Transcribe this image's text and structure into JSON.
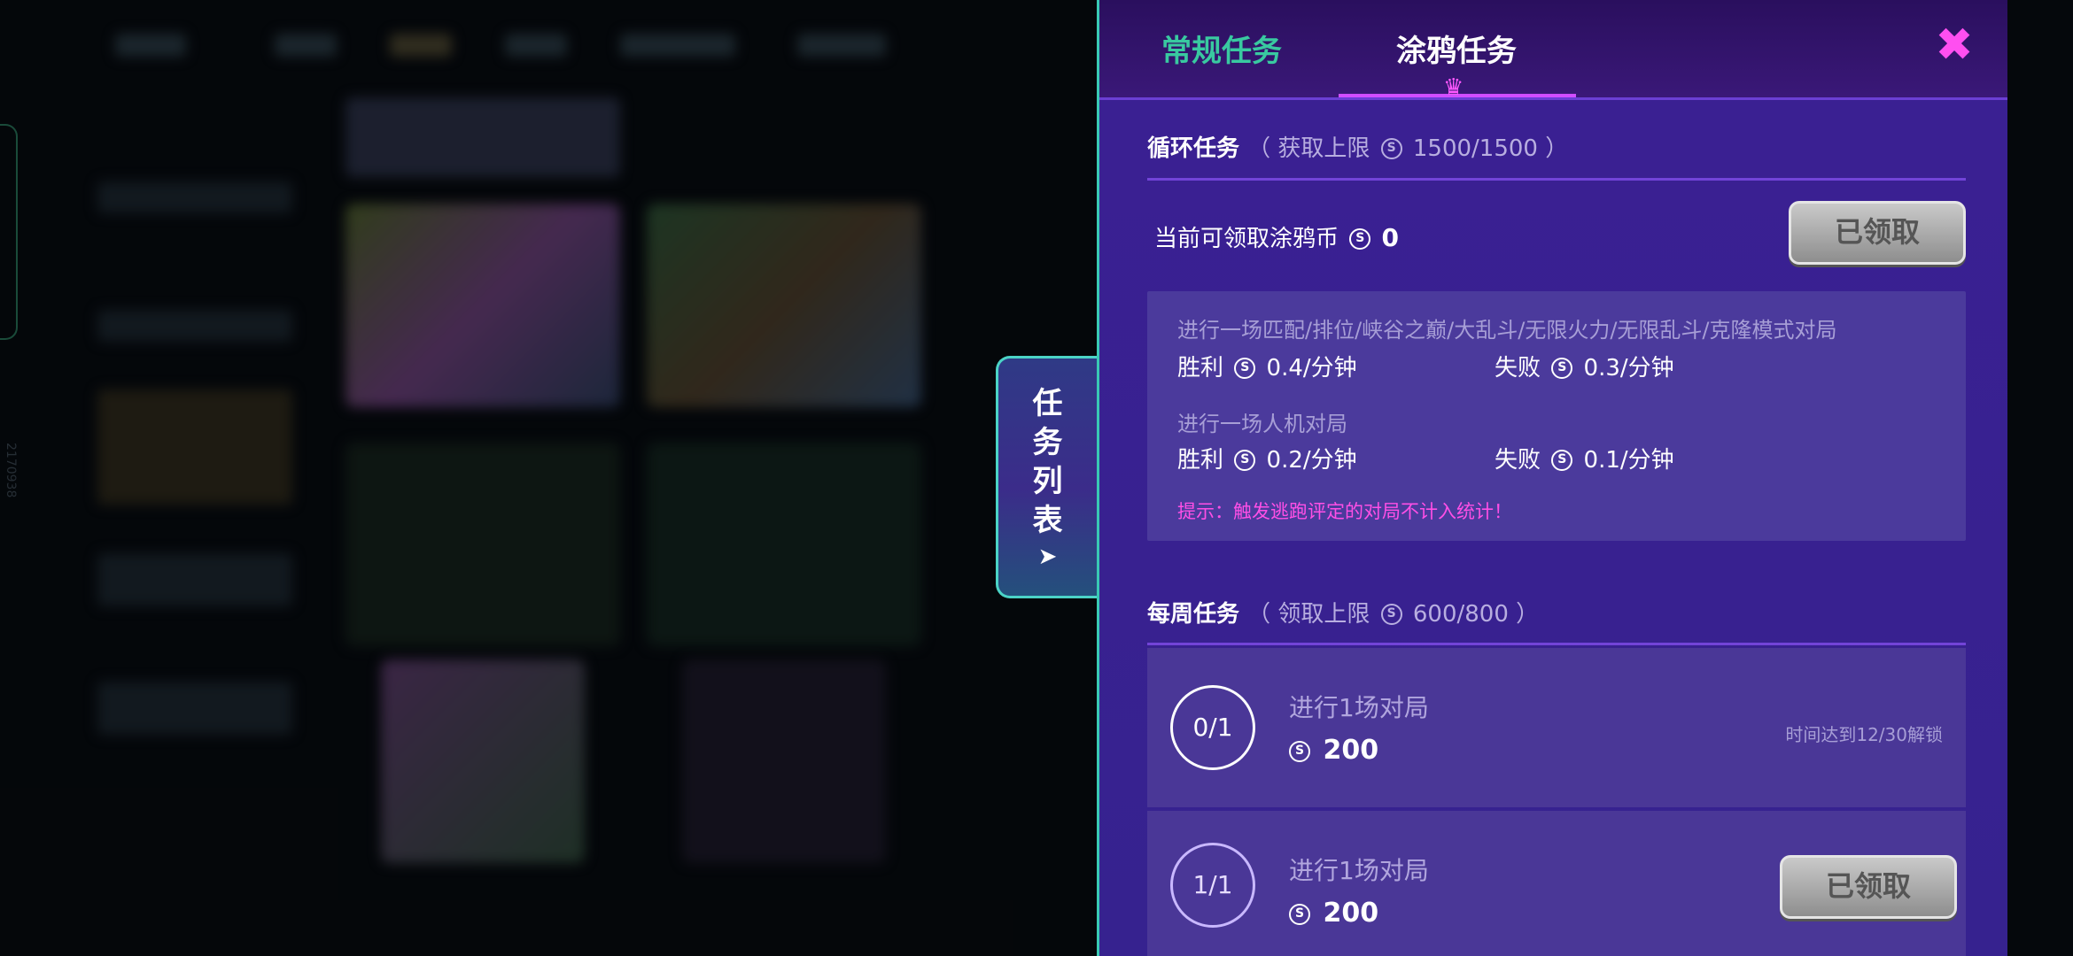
{
  "background": {
    "side_text": "2170938"
  },
  "handle": {
    "label_chars": [
      "任",
      "务",
      "列",
      "表"
    ]
  },
  "tabs": {
    "regular": "常规任务",
    "graffiti": "涂鸦任务"
  },
  "cyclic": {
    "title": "循环任务",
    "limit_label": "（ 获取上限",
    "limit_value": "1500/1500 ）",
    "current_label": "当前可领取涂鸦币",
    "current_value": "0",
    "claim_button": "已领取",
    "line1": "进行一场匹配/排位/峡谷之巅/大乱斗/无限火力/无限乱斗/克隆模式对局",
    "win_label": "胜利",
    "win_rate1": "0.4/分钟",
    "lose_label": "失败",
    "lose_rate1": "0.3/分钟",
    "line2": "进行一场人机对局",
    "win_rate2": "0.2/分钟",
    "lose_rate2": "0.1/分钟",
    "tip": "提示：触发逃跑评定的对局不计入统计！"
  },
  "weekly": {
    "title": "每周任务",
    "limit_label": "（ 领取上限",
    "limit_value": "600/800 ）",
    "tasks": [
      {
        "progress": "0/1",
        "title": "进行1场对局",
        "reward": "200",
        "status": "时间达到12/30解锁"
      },
      {
        "progress": "1/1",
        "title": "进行1场对局",
        "reward": "200",
        "button": "已领取"
      }
    ]
  },
  "colors": {
    "panel": "#3a1f8c",
    "tab_active_underline": "#d04dff",
    "close": "#ff4ff0",
    "tip": "#ff4fe6",
    "tab_inactive": "#39c9a0"
  },
  "icons": [
    "coin-icon",
    "close-icon",
    "chevron-icon"
  ]
}
